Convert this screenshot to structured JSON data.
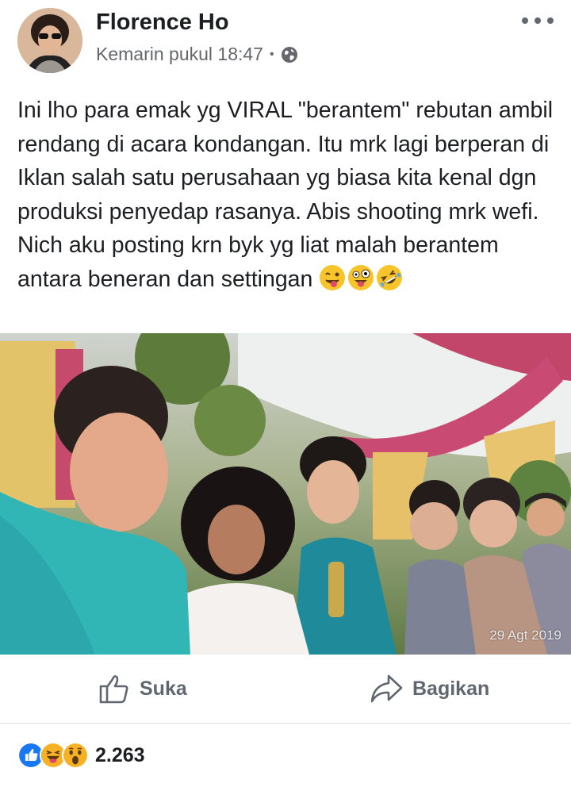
{
  "post": {
    "author": "Florence Ho",
    "timestamp": "Kemarin pukul 18:47",
    "separator": "•",
    "privacy_icon": "globe-icon",
    "text": "Ini lho para emak yg VIRAL \"berantem\" rebutan ambil rendang di acara kondangan. Itu mrk lagi berperan di Iklan salah satu perusahaan yg biasa kita kenal dgn produksi penyedap rasanya. Abis shooting mrk wefi. Nich aku posting krn byk yg liat malah berantem antara beneran dan settingan",
    "text_emojis": [
      "winking-tongue-emoji",
      "zany-face-emoji",
      "rolling-laughing-emoji"
    ],
    "photo_date": "29 Agt 2019"
  },
  "actions": {
    "like_label": "Suka",
    "share_label": "Bagikan"
  },
  "reactions": {
    "icons": [
      "like-reaction-icon",
      "haha-reaction-icon",
      "wow-reaction-icon"
    ],
    "count": "2.263"
  },
  "colors": {
    "like_blue": "#1877f2",
    "reaction_yellow": "#f7b125",
    "meta_gray": "#65676b"
  }
}
